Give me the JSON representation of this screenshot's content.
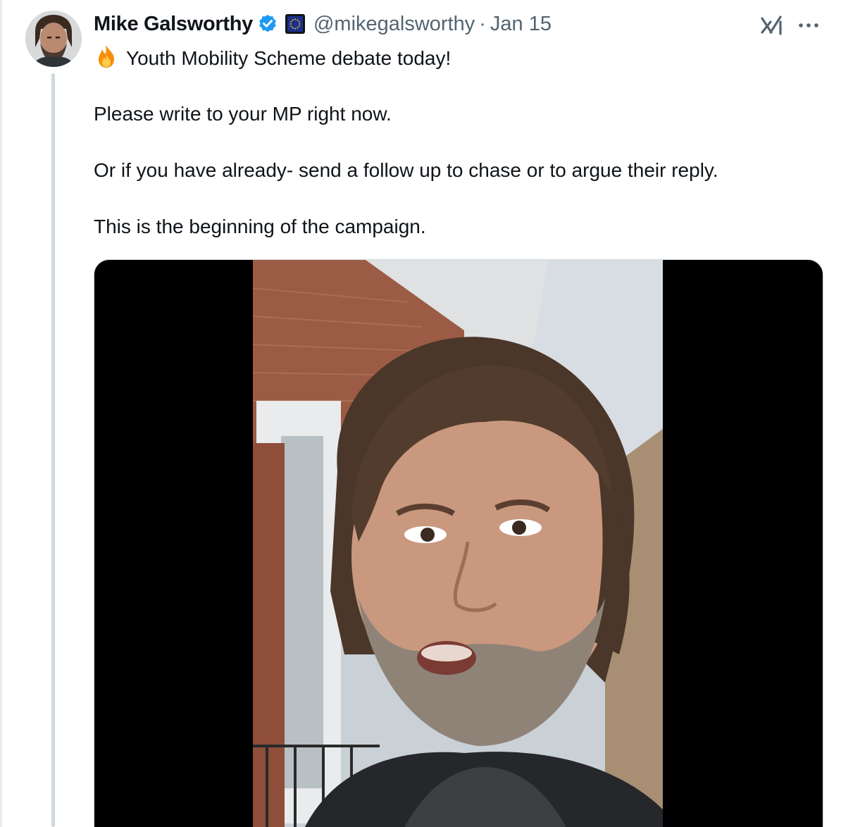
{
  "tweet": {
    "author": {
      "display_name": "Mike Galsworthy",
      "handle": "@mikegalsworthy",
      "verified": true,
      "affiliate_badge": "eu-flag-icon"
    },
    "separator": "·",
    "date": "Jan 15",
    "lines": [
      "Youth Mobility Scheme debate today!",
      "Please write to your MP right now.",
      "Or if you have already- send a follow up to chase or to argue their reply.",
      "This is the beginning of the campaign."
    ],
    "leading_emoji": "fire-icon",
    "media": {
      "type": "video",
      "letterboxed": true
    }
  },
  "actions": {
    "grok_icon": "grok-icon",
    "more_icon": "more-icon"
  },
  "colors": {
    "text": "#0f1419",
    "muted": "#536471",
    "verified": "#1d9bf0",
    "thread_line": "#cfd9de",
    "media_border": "#cfd9de",
    "letterbox": "#000000"
  }
}
